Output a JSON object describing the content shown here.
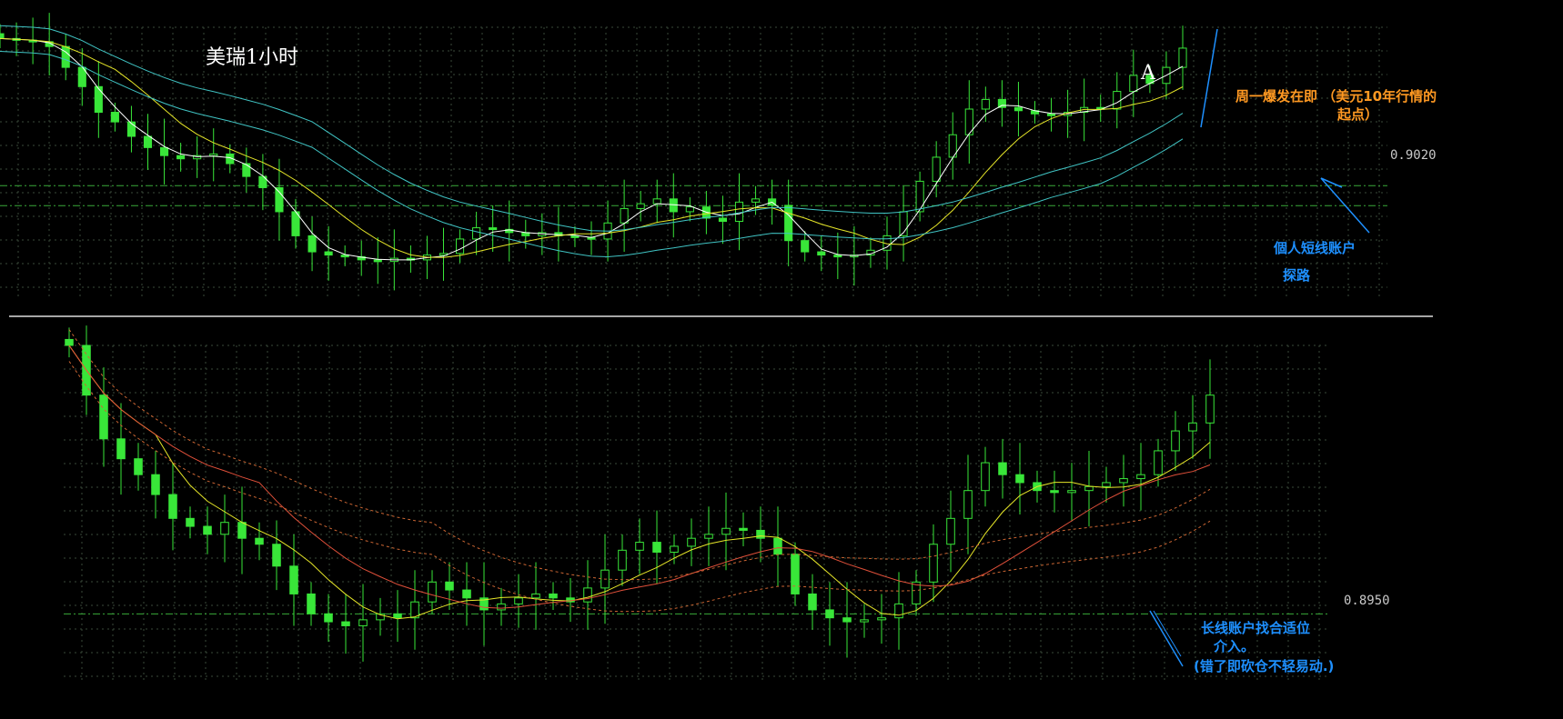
{
  "chart_data": [
    {
      "type": "candlestick",
      "title": "美瑞1小时",
      "ylim": [
        0.8955,
        0.9125
      ],
      "grid": true,
      "reference_lines": [
        0.902
      ],
      "price_label": "0.9020",
      "point_marker": "A",
      "series": [
        {
          "name": "",
          "values": [
            0.9118,
            0.9117,
            0.9116,
            0.9113,
            0.91,
            0.9088,
            0.9072,
            0.9066,
            0.9057,
            0.905,
            0.9045,
            0.9043,
            0.9045,
            0.9046,
            0.904,
            0.9032,
            0.9025,
            0.901,
            0.8995,
            0.8985,
            0.8983,
            0.8982,
            0.898,
            0.8979,
            0.8981,
            0.898,
            0.8983,
            0.8984,
            0.8993,
            0.9,
            0.8999,
            0.8997,
            0.8995,
            0.8997,
            0.8995,
            0.8994,
            0.8993,
            0.9003,
            0.9012,
            0.9015,
            0.9018,
            0.901,
            0.9013,
            0.9006,
            0.9004,
            0.9016,
            0.9018,
            0.9014,
            0.8992,
            0.8985,
            0.8983,
            0.8982,
            0.8983,
            0.8986,
            0.8995,
            0.901,
            0.9029,
            0.9044,
            0.9058,
            0.9074,
            0.908,
            0.9075,
            0.9073,
            0.9071,
            0.907,
            0.9072,
            0.9075,
            0.9074,
            0.9085,
            0.9095,
            0.909,
            0.91,
            0.9112
          ]
        }
      ]
    },
    {
      "type": "candlestick",
      "title": "",
      "ylim": [
        0.8925,
        0.9085
      ],
      "grid": true,
      "reference_lines": [
        0.895
      ],
      "price_label": "0.8950",
      "series": [
        {
          "name": "",
          "values": [
            0.9085,
            0.906,
            0.9038,
            0.9028,
            0.902,
            0.901,
            0.8998,
            0.8994,
            0.899,
            0.8996,
            0.8988,
            0.8985,
            0.8974,
            0.896,
            0.895,
            0.8946,
            0.8944,
            0.8947,
            0.895,
            0.8948,
            0.8956,
            0.8966,
            0.8962,
            0.8958,
            0.8952,
            0.8955,
            0.8958,
            0.896,
            0.8958,
            0.8956,
            0.8963,
            0.8972,
            0.8982,
            0.8986,
            0.8981,
            0.8984,
            0.8988,
            0.899,
            0.8993,
            0.8992,
            0.8988,
            0.898,
            0.896,
            0.8952,
            0.8948,
            0.8946,
            0.8947,
            0.8948,
            0.8955,
            0.8966,
            0.8985,
            0.8998,
            0.9012,
            0.9026,
            0.902,
            0.9016,
            0.9012,
            0.9011,
            0.9012,
            0.9014,
            0.9016,
            0.9018,
            0.902,
            0.9032,
            0.9042,
            0.9046,
            0.906
          ]
        }
      ]
    }
  ],
  "annotations": {
    "line1_a": "周一爆发在即  （美元10年行情的",
    "line1_b": "起点）",
    "line2": "個人短线账户",
    "line3": "探路",
    "line4": "长线账户找合适位",
    "line5": "介入。",
    "line6": "(错了即砍仓不轻易动.)"
  },
  "colors": {
    "background": "#000000",
    "candle": "#39e639",
    "grid": "#3a4a3a",
    "ma_white": "#ffffff",
    "ma_yellow": "#e6e628",
    "ma_cyan": "#40c4c4",
    "ma_red": "#e0503a",
    "ma_orange_dashed": "#cc6633",
    "ref_line": "#3aaa3a",
    "annotation_orange": "#ff9922",
    "annotation_blue": "#1e90ff"
  }
}
